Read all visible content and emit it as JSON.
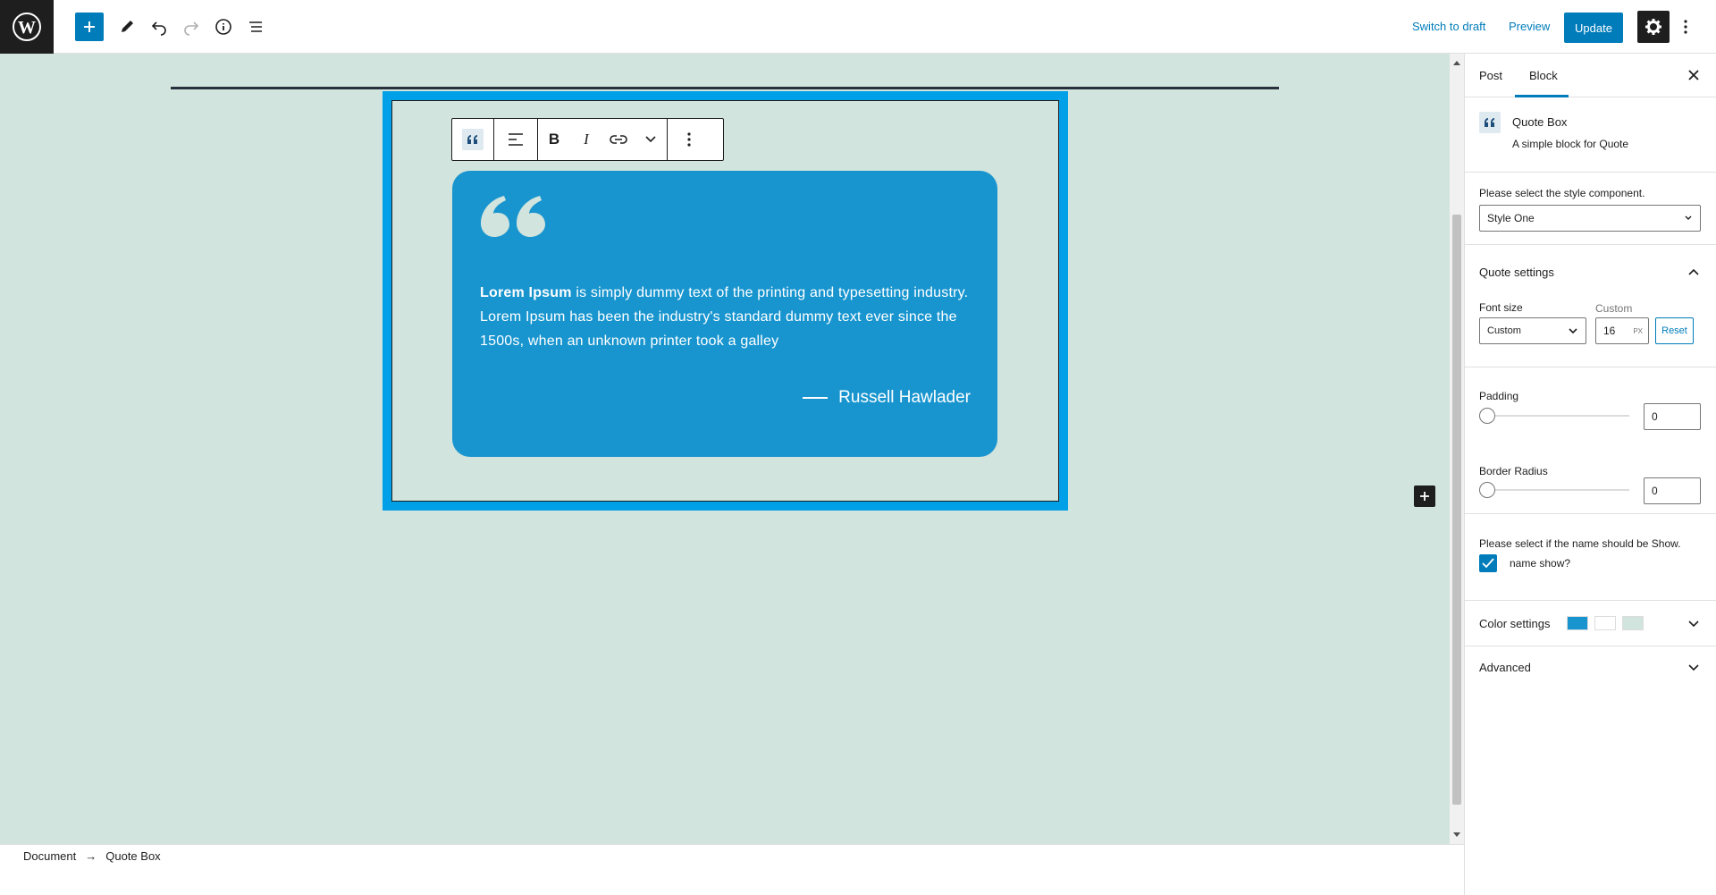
{
  "topbar": {
    "logo_icon": "wordpress-logo",
    "add_icon": "plus-icon",
    "tools_icon": "pencil-icon",
    "undo_icon": "undo-icon",
    "redo_icon": "redo-icon",
    "info_icon": "info-icon",
    "list_icon": "list-view-icon",
    "switch_to_draft": "Switch to draft",
    "preview": "Preview",
    "update": "Update",
    "settings_icon": "gear-icon",
    "more_icon": "vertical-ellipsis-icon"
  },
  "block": {
    "toolbar": {
      "quote_icon": "quote-icon",
      "align_icon": "align-left-icon",
      "bold": "B",
      "italic": "I",
      "link_icon": "link-icon",
      "more_rich_icon": "chevron-down-icon",
      "options_icon": "vertical-ellipsis-icon"
    },
    "quote": {
      "text_bold": "Lorem Ipsum",
      "text_rest": " is simply dummy text of the printing and typesetting industry. Lorem Ipsum has been the industry's standard dummy text ever since the 1500s, when an unknown printer took a galley",
      "author": "Russell Hawlader"
    }
  },
  "footer": {
    "crumb_document": "Document",
    "crumb_arrow": "→",
    "crumb_block": "Quote Box"
  },
  "sidebar": {
    "tabs": {
      "post": "Post",
      "block": "Block"
    },
    "block_card": {
      "title": "Quote Box",
      "description": "A simple block for Quote"
    },
    "style": {
      "label": "Please select the style component.",
      "value": "Style One"
    },
    "quote_settings": {
      "title": "Quote settings",
      "font_size_label": "Font size",
      "custom_label": "Custom",
      "font_size_select": "Custom",
      "font_size_value": "16",
      "unit": "PX",
      "reset": "Reset",
      "padding_label": "Padding",
      "padding_value": "0",
      "border_radius_label": "Border Radius",
      "border_radius_value": "0",
      "name_show_label": "Please select if the name should be Show.",
      "name_show_checkbox": "name show?",
      "name_show_checked": true
    },
    "color_settings": {
      "title": "Color settings",
      "swatches": [
        "#1895cf",
        "#ffffff",
        "#d1e4dd"
      ]
    },
    "advanced": {
      "title": "Advanced"
    }
  },
  "colors": {
    "accent": "#007cba",
    "canvas_bg": "#d1e4dd",
    "quote_bg": "#1895cf",
    "block_border": "#00a0e9"
  }
}
